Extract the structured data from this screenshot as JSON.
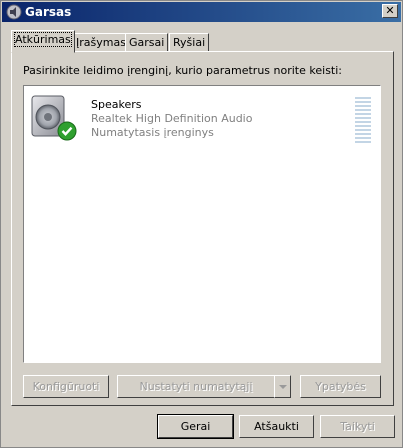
{
  "window": {
    "title": "Garsas",
    "close_symbol": "✕"
  },
  "tabs": [
    {
      "label": "Atkūrimas",
      "active": true
    },
    {
      "label": "Įrašymas",
      "active": false
    },
    {
      "label": "Garsai",
      "active": false
    },
    {
      "label": "Ryšiai",
      "active": false
    }
  ],
  "main": {
    "instruction": "Pasirinkite leidimo įrenginį, kurio parametrus norite keisti:",
    "devices": [
      {
        "name": "Speakers",
        "driver": "Realtek High Definition Audio",
        "status": "Numatytasis įrenginys",
        "icon": "speaker-default-icon",
        "level": 0
      }
    ]
  },
  "device_buttons": {
    "configure": "Konfigūruoti",
    "set_default": "Nustatyti numatytąjį",
    "properties": "Ypatybės"
  },
  "dialog_buttons": {
    "ok": "Gerai",
    "cancel": "Atšaukti",
    "apply": "Taikyti"
  },
  "colors": {
    "titlebar_start": "#0a246a",
    "titlebar_end": "#3a6ea5",
    "face": "#d4d0c8",
    "check_green": "#2fa02f",
    "disabled_text": "#9a9a9a"
  }
}
